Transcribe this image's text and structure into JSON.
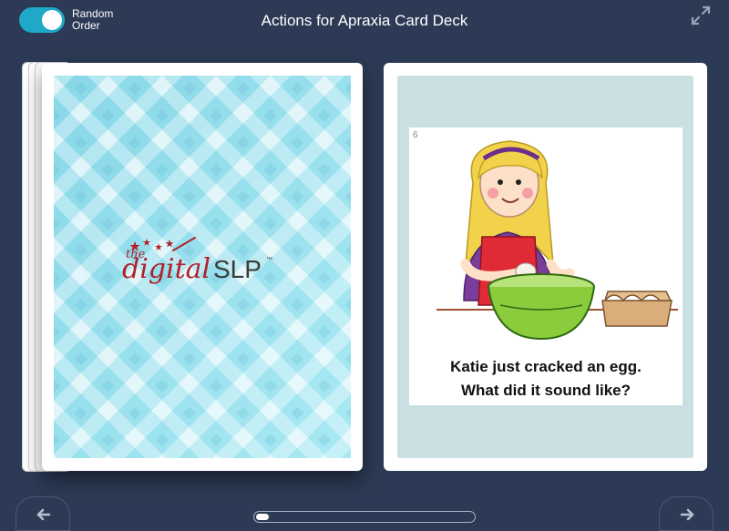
{
  "header": {
    "title": "Actions for Apraxia Card Deck",
    "random_order": {
      "label_line1": "Random",
      "label_line2": "Order",
      "enabled": true
    },
    "expand_icon": "expand-icon"
  },
  "left_card": {
    "logo": {
      "the": "the",
      "digital": "digital",
      "slp": "SLP",
      "tm": "™"
    }
  },
  "right_card": {
    "number": "6",
    "caption_line1": "Katie just cracked an egg.",
    "caption_line2": "What did it sound like?"
  },
  "footer": {
    "prev_icon": "arrow-left-icon",
    "next_icon": "arrow-right-icon",
    "progress": 0.06
  },
  "colors": {
    "background": "#2c3a55",
    "accent": "#1fa9c6",
    "card_panel": "#c9dfe2"
  }
}
